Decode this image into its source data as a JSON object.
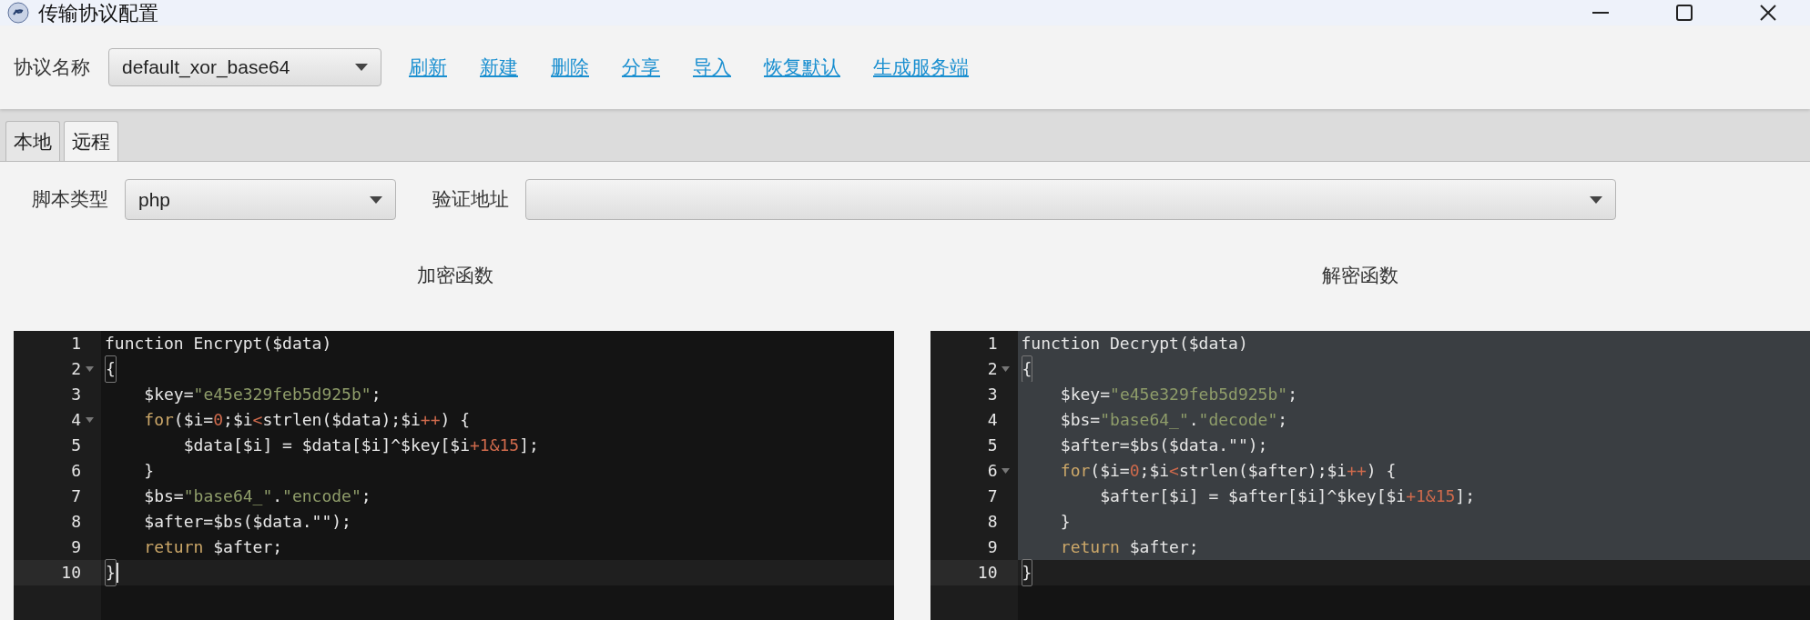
{
  "window": {
    "title": "传输协议配置"
  },
  "toolbar": {
    "label": "协议名称",
    "protocol": "default_xor_base64",
    "links": [
      "刷新",
      "新建",
      "删除",
      "分享",
      "导入",
      "恢复默认",
      "生成服务端"
    ]
  },
  "tabs": [
    {
      "label": "本地",
      "selected": false
    },
    {
      "label": "远程",
      "selected": true
    }
  ],
  "form": {
    "script_type_label": "脚本类型",
    "script_type": "php",
    "verify_url_label": "验证地址"
  },
  "editors": [
    {
      "title": "加密函数",
      "lines": [
        {
          "n": "1",
          "fold": false,
          "selected": false,
          "active": false,
          "tokens": [
            {
              "t": "function Encrypt($data)",
              "kind": "plain"
            }
          ]
        },
        {
          "n": "2",
          "fold": true,
          "selected": false,
          "active": false,
          "tokens": [
            {
              "t": "{",
              "kind": "bracket"
            }
          ]
        },
        {
          "n": "3",
          "fold": false,
          "selected": false,
          "active": false,
          "tokens": [
            {
              "t": "    $key=",
              "kind": "plain"
            },
            {
              "t": "\"e45e329feb5d925b\"",
              "kind": "string"
            },
            {
              "t": ";",
              "kind": "plain"
            }
          ]
        },
        {
          "n": "4",
          "fold": true,
          "selected": false,
          "active": false,
          "tokens": [
            {
              "t": "    for",
              "kind": "keyword"
            },
            {
              "t": "($i=",
              "kind": "plain"
            },
            {
              "t": "0",
              "kind": "number"
            },
            {
              "t": ";$i",
              "kind": "plain"
            },
            {
              "t": "<",
              "kind": "operator"
            },
            {
              "t": "strlen($data);$i",
              "kind": "plain"
            },
            {
              "t": "++",
              "kind": "operator"
            },
            {
              "t": ") {",
              "kind": "plain"
            }
          ]
        },
        {
          "n": "5",
          "fold": false,
          "selected": false,
          "active": false,
          "tokens": [
            {
              "t": "        $data[$i] = $data[$i]^$key[$i",
              "kind": "plain"
            },
            {
              "t": "+1&15",
              "kind": "operator"
            },
            {
              "t": "];",
              "kind": "plain"
            }
          ]
        },
        {
          "n": "6",
          "fold": false,
          "selected": false,
          "active": false,
          "tokens": [
            {
              "t": "    }",
              "kind": "plain"
            }
          ]
        },
        {
          "n": "7",
          "fold": false,
          "selected": false,
          "active": false,
          "tokens": [
            {
              "t": "    $bs=",
              "kind": "plain"
            },
            {
              "t": "\"base64_\"",
              "kind": "string"
            },
            {
              "t": ".",
              "kind": "plain"
            },
            {
              "t": "\"encode\"",
              "kind": "string"
            },
            {
              "t": ";",
              "kind": "plain"
            }
          ]
        },
        {
          "n": "8",
          "fold": false,
          "selected": false,
          "active": false,
          "tokens": [
            {
              "t": "    $after=$bs($data.\"\");",
              "kind": "plain"
            }
          ]
        },
        {
          "n": "9",
          "fold": false,
          "selected": false,
          "active": false,
          "tokens": [
            {
              "t": "    return",
              "kind": "keyword"
            },
            {
              "t": " $after;",
              "kind": "plain"
            }
          ]
        },
        {
          "n": "10",
          "fold": false,
          "selected": false,
          "active": true,
          "tokens": [
            {
              "t": "}",
              "kind": "bracket"
            }
          ]
        }
      ]
    },
    {
      "title": "解密函数",
      "lines": [
        {
          "n": "1",
          "fold": false,
          "selected": true,
          "active": false,
          "tokens": [
            {
              "t": "function Decrypt($data)",
              "kind": "plain"
            }
          ]
        },
        {
          "n": "2",
          "fold": true,
          "selected": true,
          "active": false,
          "tokens": [
            {
              "t": "{",
              "kind": "bracket"
            }
          ]
        },
        {
          "n": "3",
          "fold": false,
          "selected": true,
          "active": false,
          "tokens": [
            {
              "t": "    $key=",
              "kind": "plain"
            },
            {
              "t": "\"e45e329feb5d925b\"",
              "kind": "string"
            },
            {
              "t": ";",
              "kind": "plain"
            }
          ]
        },
        {
          "n": "4",
          "fold": false,
          "selected": true,
          "active": false,
          "tokens": [
            {
              "t": "    $bs=",
              "kind": "plain"
            },
            {
              "t": "\"base64_\"",
              "kind": "string"
            },
            {
              "t": ".",
              "kind": "plain"
            },
            {
              "t": "\"decode\"",
              "kind": "string"
            },
            {
              "t": ";",
              "kind": "plain"
            }
          ]
        },
        {
          "n": "5",
          "fold": false,
          "selected": true,
          "active": false,
          "tokens": [
            {
              "t": "    $after=$bs($data.\"\");",
              "kind": "plain"
            }
          ]
        },
        {
          "n": "6",
          "fold": true,
          "selected": true,
          "active": false,
          "tokens": [
            {
              "t": "    for",
              "kind": "keyword"
            },
            {
              "t": "($i=",
              "kind": "plain"
            },
            {
              "t": "0",
              "kind": "number"
            },
            {
              "t": ";$i",
              "kind": "plain"
            },
            {
              "t": "<",
              "kind": "operator"
            },
            {
              "t": "strlen($after);$i",
              "kind": "plain"
            },
            {
              "t": "++",
              "kind": "operator"
            },
            {
              "t": ") {",
              "kind": "plain"
            }
          ]
        },
        {
          "n": "7",
          "fold": false,
          "selected": true,
          "active": false,
          "tokens": [
            {
              "t": "        $after[$i] = $after[$i]^$key[$i",
              "kind": "plain"
            },
            {
              "t": "+1&15",
              "kind": "operator"
            },
            {
              "t": "];",
              "kind": "plain"
            }
          ]
        },
        {
          "n": "8",
          "fold": false,
          "selected": true,
          "active": false,
          "tokens": [
            {
              "t": "    }",
              "kind": "plain"
            }
          ]
        },
        {
          "n": "9",
          "fold": false,
          "selected": true,
          "active": false,
          "tokens": [
            {
              "t": "    return",
              "kind": "keyword"
            },
            {
              "t": " $after;",
              "kind": "plain"
            }
          ]
        },
        {
          "n": "10",
          "fold": false,
          "selected": false,
          "active": true,
          "tokens": [
            {
              "t": "}",
              "kind": "bracket"
            }
          ]
        }
      ]
    }
  ]
}
